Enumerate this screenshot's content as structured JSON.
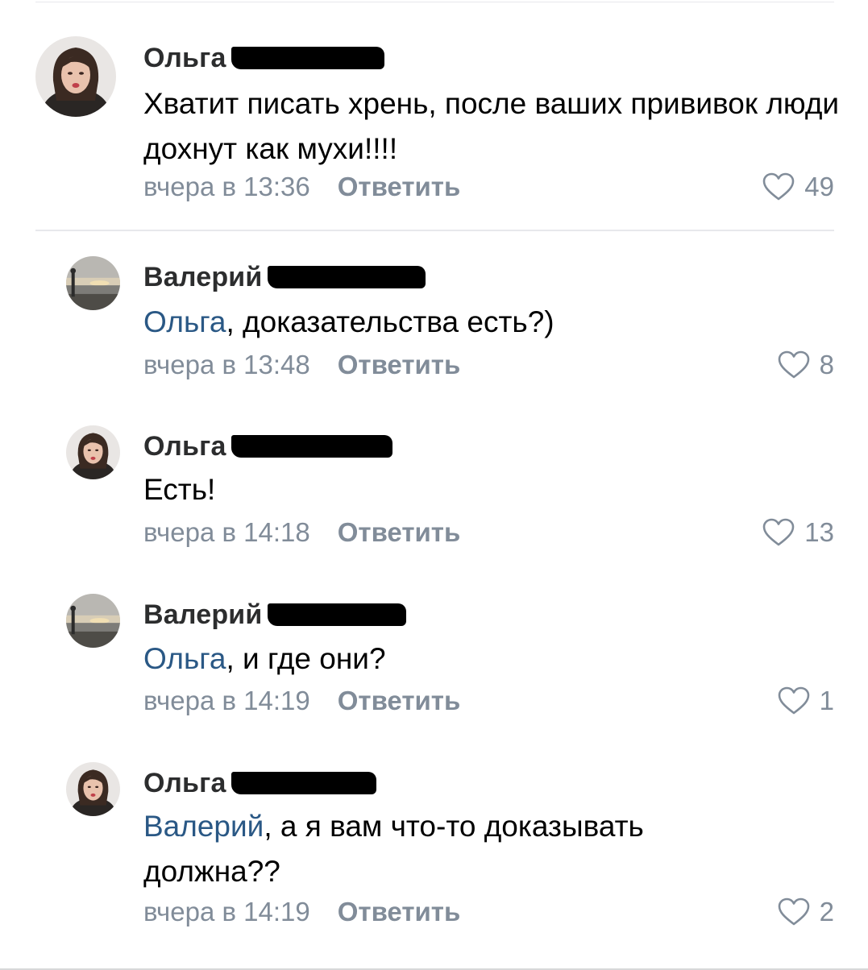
{
  "comments": [
    {
      "author": "Ольга",
      "text": "Хватит писать хрень, после ваших прививок люди дохнут как мухи!!!!",
      "mention": "",
      "mention_suffix": "",
      "time": "вчера в 13:36",
      "reply_label": "Ответить",
      "likes": "49",
      "avatar": "woman-portrait"
    },
    {
      "author": "Валерий",
      "mention": "Ольга",
      "mention_suffix": ", доказательства есть?)",
      "time": "вчера в 13:48",
      "reply_label": "Ответить",
      "likes": "8",
      "avatar": "sunset-seaside"
    },
    {
      "author": "Ольга",
      "text": "Есть!",
      "mention": "",
      "mention_suffix": "",
      "time": "вчера в 14:18",
      "reply_label": "Ответить",
      "likes": "13",
      "avatar": "woman-portrait"
    },
    {
      "author": "Валерий",
      "mention": "Ольга",
      "mention_suffix": ", и где они?",
      "time": "вчера в 14:19",
      "reply_label": "Ответить",
      "likes": "1",
      "avatar": "sunset-seaside"
    },
    {
      "author": "Ольга",
      "mention": "Валерий",
      "mention_suffix": ", а я вам что-то доказывать",
      "mention_suffix_line2": "должна??",
      "time": "вчера в 14:19",
      "reply_label": "Ответить",
      "likes": "2",
      "avatar": "woman-portrait"
    }
  ],
  "colors": {
    "mention": "#2a5885",
    "meta": "#818c99",
    "name": "#2c2d2e",
    "divider": "#e7e8ec"
  }
}
